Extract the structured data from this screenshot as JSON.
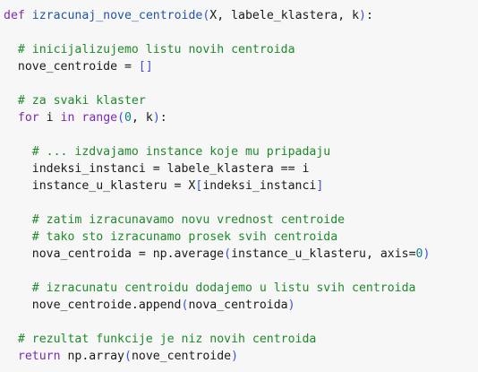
{
  "code": {
    "lines": [
      [
        {
          "t": "kw",
          "v": "def"
        },
        {
          "t": "pl",
          "v": " "
        },
        {
          "t": "fn",
          "v": "izracunaj_nove_centroide"
        },
        {
          "t": "br",
          "v": "("
        },
        {
          "t": "pl",
          "v": "X, labele_klastera, k"
        },
        {
          "t": "br",
          "v": ")"
        },
        {
          "t": "pl",
          "v": ":"
        }
      ],
      [],
      [
        {
          "t": "pl",
          "v": "  "
        },
        {
          "t": "cm",
          "v": "# inicijalizujemo listu novih centroida"
        }
      ],
      [
        {
          "t": "pl",
          "v": "  nove_centroide = "
        },
        {
          "t": "br",
          "v": "[]"
        }
      ],
      [],
      [
        {
          "t": "pl",
          "v": "  "
        },
        {
          "t": "cm",
          "v": "# za svaki klaster"
        }
      ],
      [
        {
          "t": "pl",
          "v": "  "
        },
        {
          "t": "kw",
          "v": "for"
        },
        {
          "t": "pl",
          "v": " i "
        },
        {
          "t": "kw",
          "v": "in"
        },
        {
          "t": "pl",
          "v": " "
        },
        {
          "t": "kw",
          "v": "range"
        },
        {
          "t": "br",
          "v": "("
        },
        {
          "t": "num",
          "v": "0"
        },
        {
          "t": "pl",
          "v": ", k"
        },
        {
          "t": "br",
          "v": ")"
        },
        {
          "t": "pl",
          "v": ":"
        }
      ],
      [],
      [
        {
          "t": "pl",
          "v": "    "
        },
        {
          "t": "cm",
          "v": "# ... izdvajamo instance koje mu pripadaju"
        }
      ],
      [
        {
          "t": "pl",
          "v": "    indeksi_instanci = labele_klastera == i"
        }
      ],
      [
        {
          "t": "pl",
          "v": "    instance_u_klasteru = X"
        },
        {
          "t": "br",
          "v": "["
        },
        {
          "t": "pl",
          "v": "indeksi_instanci"
        },
        {
          "t": "br",
          "v": "]"
        }
      ],
      [],
      [
        {
          "t": "pl",
          "v": "    "
        },
        {
          "t": "cm",
          "v": "# zatim izracunavamo novu vrednost centroide"
        }
      ],
      [
        {
          "t": "pl",
          "v": "    "
        },
        {
          "t": "cm",
          "v": "# tako sto izracunamo prosek svih centroida"
        }
      ],
      [
        {
          "t": "pl",
          "v": "    nova_centroida = np.average"
        },
        {
          "t": "br",
          "v": "("
        },
        {
          "t": "pl",
          "v": "instance_u_klasteru, axis="
        },
        {
          "t": "num",
          "v": "0"
        },
        {
          "t": "br",
          "v": ")"
        }
      ],
      [],
      [
        {
          "t": "pl",
          "v": "    "
        },
        {
          "t": "cm",
          "v": "# izracunatu centroidu dodajemo u listu svih centroida"
        }
      ],
      [
        {
          "t": "pl",
          "v": "    nove_centroide.append"
        },
        {
          "t": "br",
          "v": "("
        },
        {
          "t": "pl",
          "v": "nova_centroida"
        },
        {
          "t": "br",
          "v": ")"
        }
      ],
      [],
      [
        {
          "t": "pl",
          "v": "  "
        },
        {
          "t": "cm",
          "v": "# rezultat funkcije je niz novih centroida"
        }
      ],
      [
        {
          "t": "pl",
          "v": "  "
        },
        {
          "t": "kw",
          "v": "return"
        },
        {
          "t": "pl",
          "v": " np.array"
        },
        {
          "t": "br",
          "v": "("
        },
        {
          "t": "pl",
          "v": "nove_centroide"
        },
        {
          "t": "br",
          "v": ")"
        }
      ]
    ]
  },
  "colors": {
    "background": "#f7f7f7",
    "keyword": "#7a2bb0",
    "function_name": "#1f55a3",
    "comment": "#1e8a2a",
    "number": "#0d7f7f",
    "bracket": "#3d4fd6",
    "plain": "#1a1a1a"
  }
}
